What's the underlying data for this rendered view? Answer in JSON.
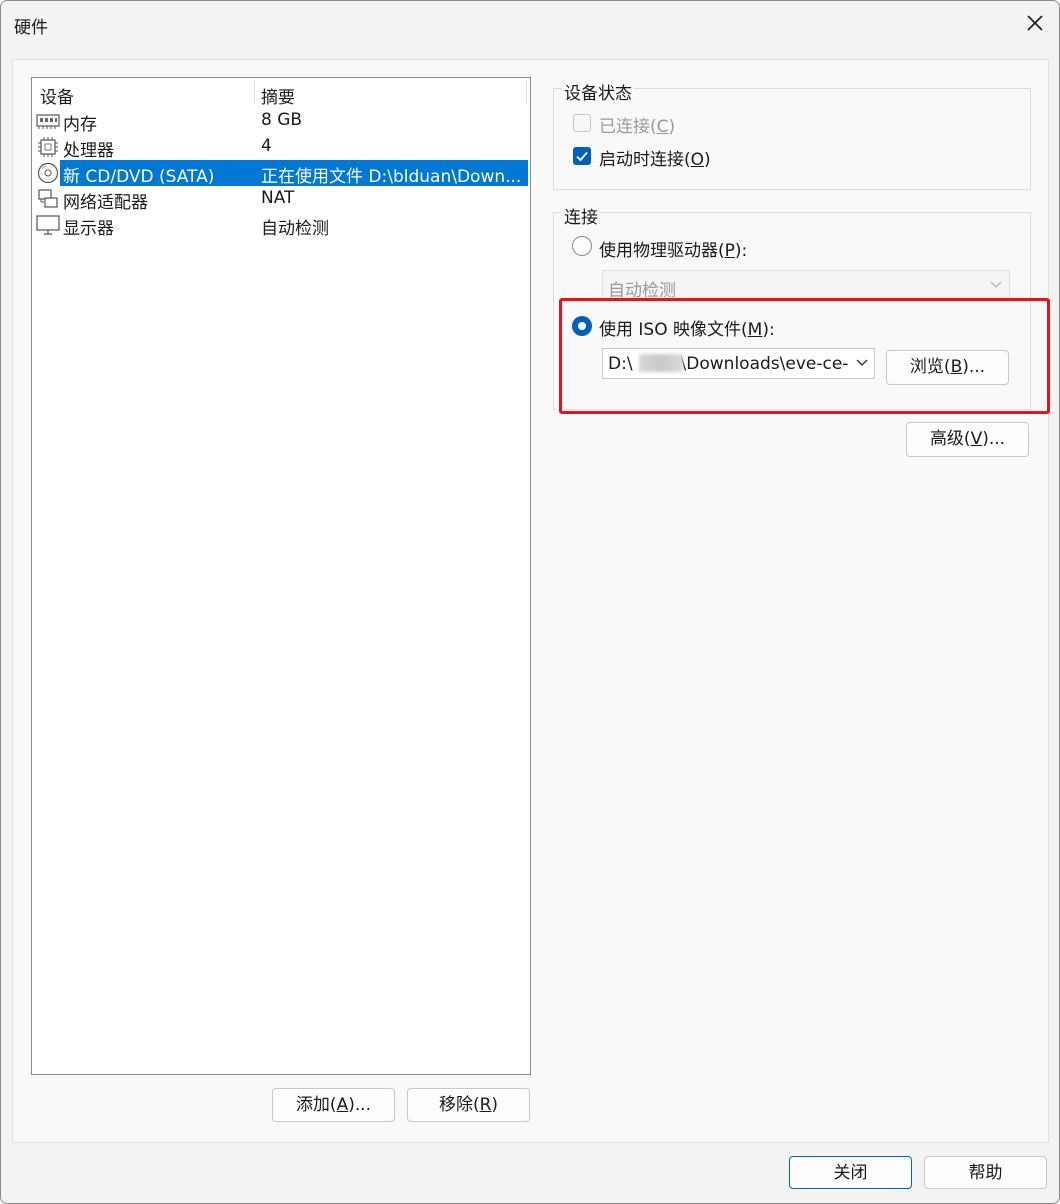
{
  "window": {
    "title": "硬件",
    "close_icon": "close-icon"
  },
  "device_list": {
    "columns": [
      "设备",
      "摘要"
    ],
    "rows": [
      {
        "name": "内存",
        "summary": "8 GB",
        "icon": "memory-icon"
      },
      {
        "name": "处理器",
        "summary": "4",
        "icon": "processor-icon"
      },
      {
        "name": "新 CD/DVD (SATA)",
        "summary": "正在使用文件 D:\\blduan\\Down...",
        "icon": "cd-dvd-icon",
        "selected": true
      },
      {
        "name": "网络适配器",
        "summary": "NAT",
        "icon": "network-adapter-icon"
      },
      {
        "name": "显示器",
        "summary": "自动检测",
        "icon": "display-icon"
      }
    ]
  },
  "list_buttons": {
    "add": {
      "pre": "添加(",
      "key": "A",
      "post": ")..."
    },
    "remove": {
      "pre": "移除(",
      "key": "R",
      "post": ")"
    }
  },
  "device_status": {
    "title": "设备状态",
    "connected": {
      "pre": "已连接(",
      "key": "C",
      "post": ")",
      "checked": false,
      "enabled": false
    },
    "connect_at_power_on": {
      "pre": "启动时连接(",
      "key": "O",
      "post": ")",
      "checked": true,
      "enabled": true
    }
  },
  "connection": {
    "title": "连接",
    "physical_drive": {
      "pre": "使用物理驱动器(",
      "key": "P",
      "post": "):",
      "selected": false
    },
    "physical_drive_value": "自动检测",
    "iso_image": {
      "pre": "使用 ISO 映像文件(",
      "key": "M",
      "post": "):",
      "selected": true
    },
    "iso_path_start": "D:\\",
    "iso_path_end": "\\Downloads\\eve-ce-p",
    "browse": {
      "pre": "浏览(",
      "key": "B",
      "post": ")..."
    }
  },
  "advanced": {
    "pre": "高级(",
    "key": "V",
    "post": ")..."
  },
  "footer": {
    "close": "关闭",
    "help": "帮助"
  },
  "colors": {
    "accent": "#005fb8",
    "selection": "#0078d4",
    "highlight_box": "#e8141a"
  }
}
